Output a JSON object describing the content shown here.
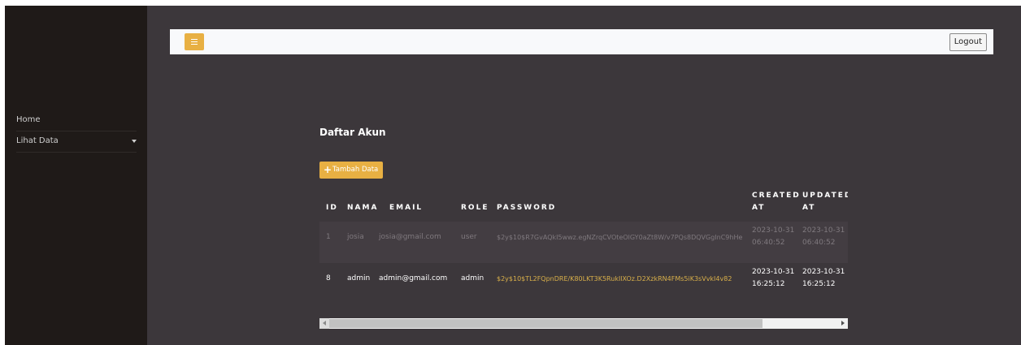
{
  "sidebar": {
    "items": [
      {
        "label": "Home"
      },
      {
        "label": "Lihat Data"
      }
    ]
  },
  "navbar": {
    "logout_label": "Logout"
  },
  "main": {
    "title": "Daftar Akun",
    "add_button_label": "Tambah Data",
    "add_button_icon": "plus-icon"
  },
  "table": {
    "headers": {
      "id": "ID",
      "nama": "NAMA",
      "email": "EMAIL",
      "role": "ROLE",
      "password": "PASSWORD",
      "created_1": "CREATED",
      "created_2": "AT",
      "updated_1": "UPDATED",
      "updated_2": "AT"
    },
    "rows": [
      {
        "id": "1",
        "nama": "josia",
        "email": "josia@gmail.com",
        "role": "user",
        "password": "$2y$10$R7GvAQkI5wwz.egNZrqCVOteOlGY0aZt8W/v7PQs8DQVGgInC9hHe",
        "created_date": "2023-10-31",
        "created_time": "06:40:52",
        "updated_date": "2023-10-31",
        "updated_time": "06:40:52"
      },
      {
        "id": "8",
        "nama": "admin",
        "email": "admin@gmail.com",
        "role": "admin",
        "password": "$2y$10$TL2FQpnDRE/K80LKT3K5RukIlXOz.D2XzkRN4FMs5iK3sVvkI4v82",
        "created_date": "2023-10-31",
        "created_time": "16:25:12",
        "updated_date": "2023-10-31",
        "updated_time": "16:25:12"
      }
    ]
  },
  "colors": {
    "accent": "#e8b043",
    "sidebar_bg": "#1f1a18",
    "content_bg": "#3c373b",
    "navbar_bg": "#f8f9fb",
    "password_text": "#d9b04a"
  }
}
